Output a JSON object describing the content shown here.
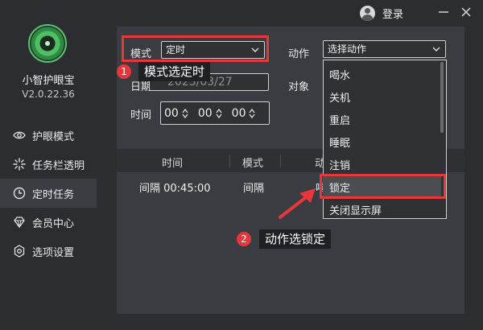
{
  "app": {
    "name": "小智护眼宝",
    "version": "V2.0.22.36"
  },
  "titlebar": {
    "login": "登录"
  },
  "sidebar": {
    "items": [
      {
        "label": "护眼模式",
        "icon": "eye-icon"
      },
      {
        "label": "任务栏透明",
        "icon": "sparkle-icon"
      },
      {
        "label": "定时任务",
        "icon": "clock-icon",
        "active": true
      },
      {
        "label": "会员中心",
        "icon": "diamond-icon"
      },
      {
        "label": "选项设置",
        "icon": "gear-icon"
      }
    ]
  },
  "form": {
    "mode_label": "模式",
    "mode_value": "定时",
    "action_label": "动作",
    "action_value": "选择动作",
    "date_label": "日期",
    "date_value": "2023/03/27",
    "target_label": "对象",
    "time_label": "时间",
    "time": {
      "h": "00",
      "m": "00",
      "s": "00"
    }
  },
  "table": {
    "headers": [
      "时间",
      "模式",
      "动"
    ],
    "row": {
      "time": "间隔 00:45:00",
      "mode": "间隔",
      "action": "喝"
    }
  },
  "dropdown": {
    "items": [
      "喝水",
      "关机",
      "重启",
      "睡眠",
      "注销",
      "锁定",
      "关闭显示屏"
    ],
    "selected": "锁定"
  },
  "annotations": {
    "step1": {
      "num": "1",
      "text": "模式选定时"
    },
    "step2": {
      "num": "2",
      "text": "动作选锁定"
    }
  },
  "colors": {
    "accent_red": "#e8363d",
    "logo_green": "#4fbf63"
  }
}
